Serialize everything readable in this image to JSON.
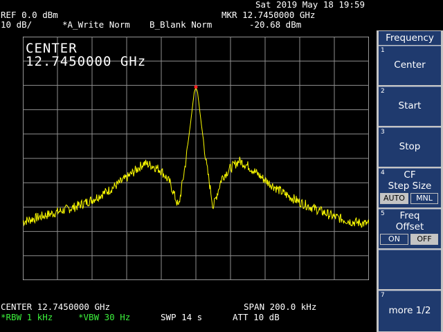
{
  "header": {
    "datetime": "Sat 2019 May 18 19:59",
    "ref_level": "REF 0.0 dBm",
    "scale": "10 dB/",
    "trace_a": "*A_Write Norm",
    "trace_b": "B_Blank Norm",
    "marker_freq": "MKR 12.7450000 GHz",
    "marker_level": "-20.68 dBm"
  },
  "display": {
    "center_label": "CENTER",
    "center_value": "12.7450000 GHz"
  },
  "footer": {
    "center": "CENTER 12.7450000 GHz",
    "span": "SPAN 200.0 kHz",
    "rbw": "*RBW 1 kHz",
    "vbw": "*VBW 30 Hz",
    "sweep": "SWP 14 s",
    "att": "ATT 10 dB"
  },
  "softkeys": {
    "menu_title": "Frequency",
    "items": [
      {
        "num": "1",
        "label": "Center"
      },
      {
        "num": "2",
        "label": "Start"
      },
      {
        "num": "3",
        "label": "Stop"
      },
      {
        "num": "4",
        "label": "CF",
        "label2": "Step Size",
        "opt_on": "AUTO",
        "opt_off": "MNL"
      },
      {
        "num": "5",
        "label": "Freq",
        "label2": "Offset",
        "opt_on": "ON",
        "opt_off": "OFF"
      },
      {
        "num": "7",
        "label": "more 1/2"
      }
    ]
  },
  "chart_data": {
    "type": "line",
    "x_unit": "kHz offset from center",
    "xlim": [
      -100,
      100
    ],
    "ylim": [
      -100,
      0
    ],
    "y_unit": "dBm",
    "grid": true,
    "trace_color": "#ffff00",
    "series": [
      {
        "x": [
          -100,
          -90,
          -80,
          -70,
          -60,
          -50,
          -40,
          -35,
          -30,
          -25,
          -20,
          -15,
          -10,
          -6,
          -3,
          -1,
          0,
          1,
          3,
          6,
          10,
          15,
          20,
          25,
          30,
          35,
          40,
          50,
          60,
          70,
          80,
          90,
          100
        ],
        "y": [
          -76,
          -74,
          -72,
          -70,
          -67,
          -63,
          -58,
          -55,
          -52,
          -53,
          -55,
          -60,
          -70,
          -52,
          -35,
          -23,
          -20.68,
          -23,
          -35,
          -52,
          -70,
          -58,
          -54,
          -51,
          -53,
          -56,
          -59,
          -64,
          -68,
          -71,
          -74,
          -76,
          -77
        ]
      }
    ],
    "marker": {
      "x": 0,
      "y": -20.68
    }
  }
}
